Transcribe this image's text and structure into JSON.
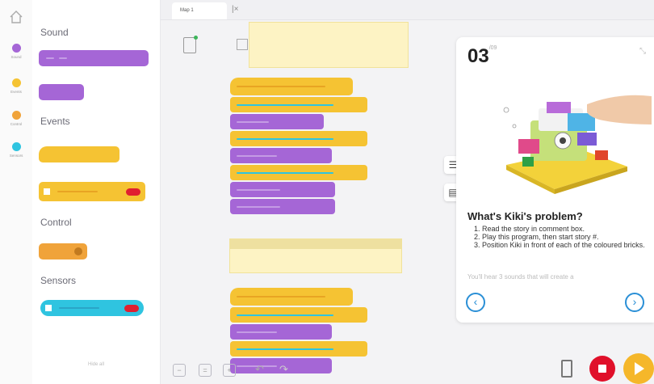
{
  "sidebar": {
    "categories": [
      {
        "label": "Sound",
        "color": "#a566d6"
      },
      {
        "label": "Events",
        "color": "#f5c333"
      },
      {
        "label": "Control",
        "color": "#f0a33a"
      },
      {
        "label": "Sensors",
        "color": "#2fc4e0"
      }
    ],
    "home_icon": "home-icon"
  },
  "palette": {
    "sections": [
      "Sound",
      "Events",
      "Control",
      "Sensors"
    ],
    "collapse_label": "Hide all"
  },
  "tabs": {
    "project_tab": "Map 1"
  },
  "panel": {
    "number": "03",
    "total": "/09",
    "title": "What's Kiki's problem?",
    "steps": [
      "Read the story in comment box.",
      "Play this program, then start story #.",
      "Position Kiki in front of each of the coloured bricks."
    ],
    "faded_text": "You'll hear 3 sounds that will create a"
  },
  "colors": {
    "sound": "#a566d6",
    "events": "#f5c333",
    "control": "#f0a33a",
    "sensors": "#2fc4e0",
    "accent": "#2a8fd6",
    "stop": "#e0102a",
    "play": "#f5b72a"
  }
}
